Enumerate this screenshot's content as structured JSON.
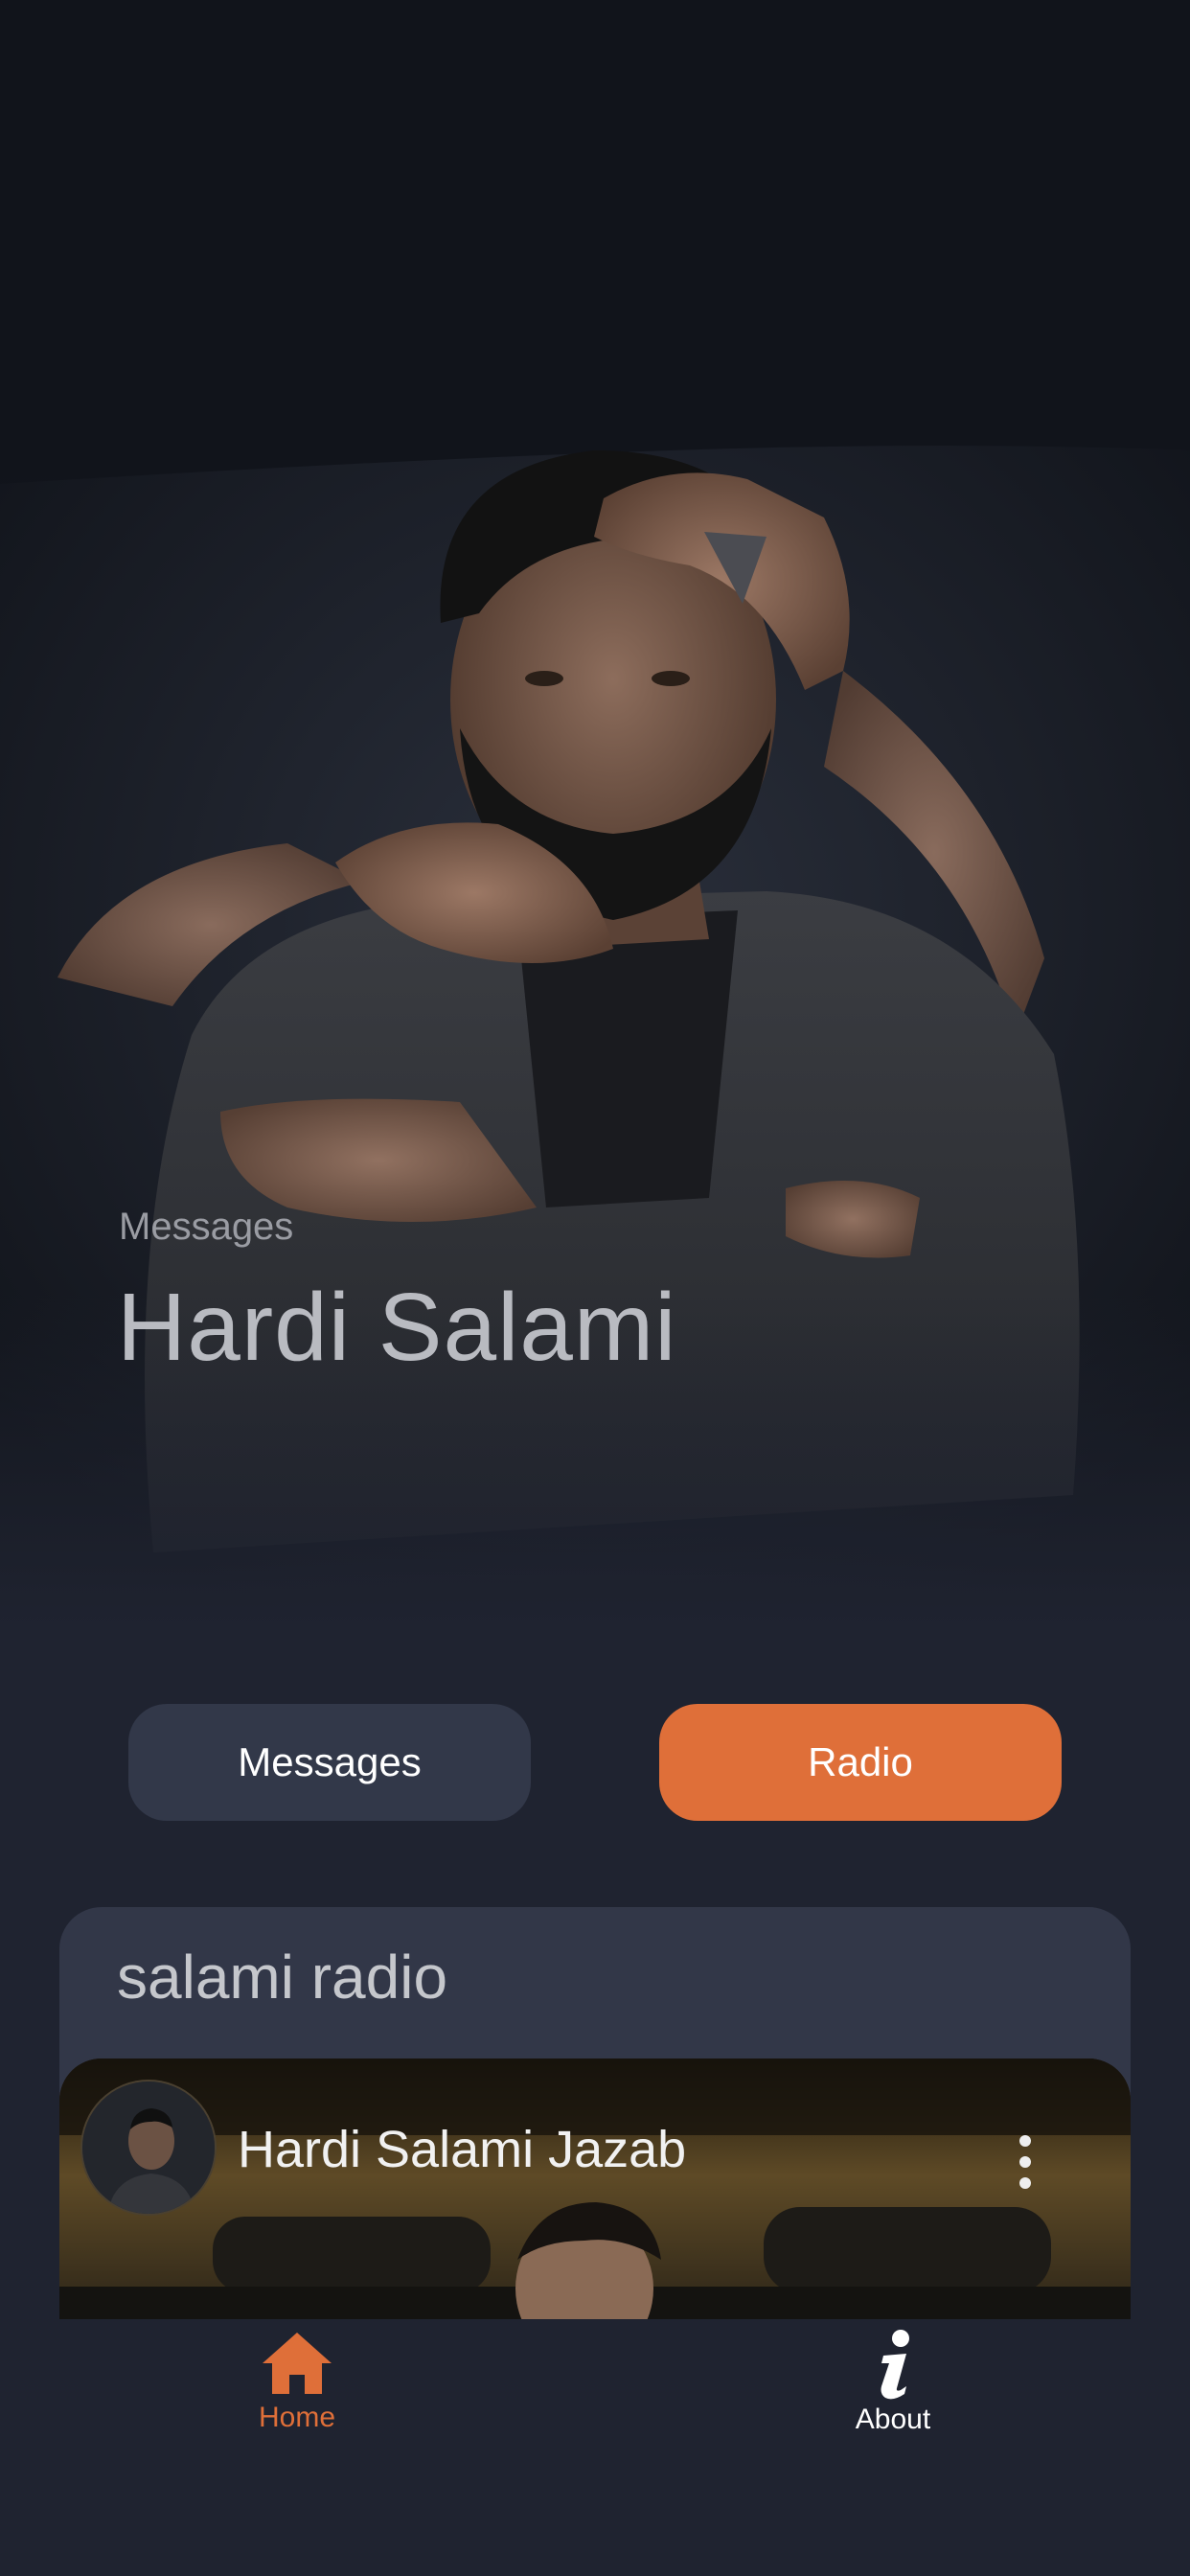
{
  "hero": {
    "subtitle": "Messages",
    "title": "Hardi Salami"
  },
  "segments": {
    "messages_label": "Messages",
    "radio_label": "Radio"
  },
  "radio": {
    "heading": "salami radio",
    "track_title": "Hardi Salami Jazab",
    "more_icon": "more-vertical-icon"
  },
  "nav": {
    "home_label": "Home",
    "home_icon": "home-icon",
    "about_label": "About",
    "about_icon": "info-icon"
  },
  "colors": {
    "accent": "#df6f39",
    "background": "#1f2330",
    "card": "#323748",
    "button_inactive": "#323849"
  }
}
